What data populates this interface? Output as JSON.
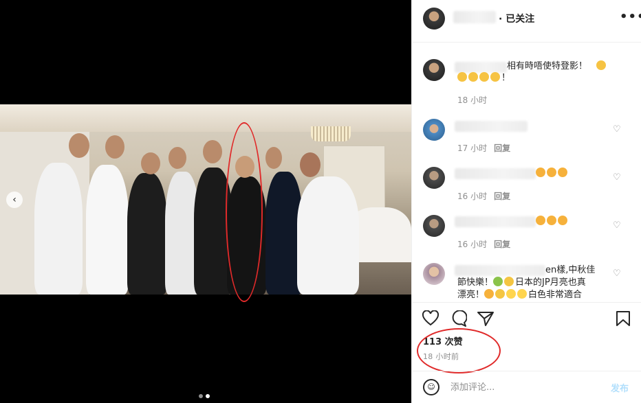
{
  "post": {
    "carousel_dots": 2,
    "active_dot": 1,
    "prev_arrow": "‹"
  },
  "header": {
    "follow_status": "· 已关注",
    "more_icon": "•••"
  },
  "comments": [
    {
      "text": "相有時唔使特登影！",
      "line2": "！",
      "time": "18 小时",
      "reply": ""
    },
    {
      "text": "",
      "time": "17 小时",
      "reply": "回复"
    },
    {
      "text": "",
      "time": "16 小时",
      "reply": "回复"
    },
    {
      "text": "",
      "time": "16 小时",
      "reply": "回复"
    },
    {
      "text": "en樣,中秋佳",
      "line2": "節快樂！",
      "line2b": "日本的JP月亮也真",
      "line3": "漂亮！",
      "line3b": "白色非常適合",
      "time": "",
      "reply": ""
    }
  ],
  "likes_text": "113 次赞",
  "time_text": "18 小时前",
  "comment_box": {
    "placeholder": "添加评论...",
    "post_label": "发布"
  },
  "icons": {
    "like": "heart-icon",
    "comment": "comment-icon",
    "share": "share-icon",
    "save": "bookmark-icon",
    "emoji": "emoji-icon"
  },
  "colors": {
    "annotation_red": "#e02a2a",
    "post_button": "#b2dffc",
    "meta_grey": "#8e8e8e"
  }
}
